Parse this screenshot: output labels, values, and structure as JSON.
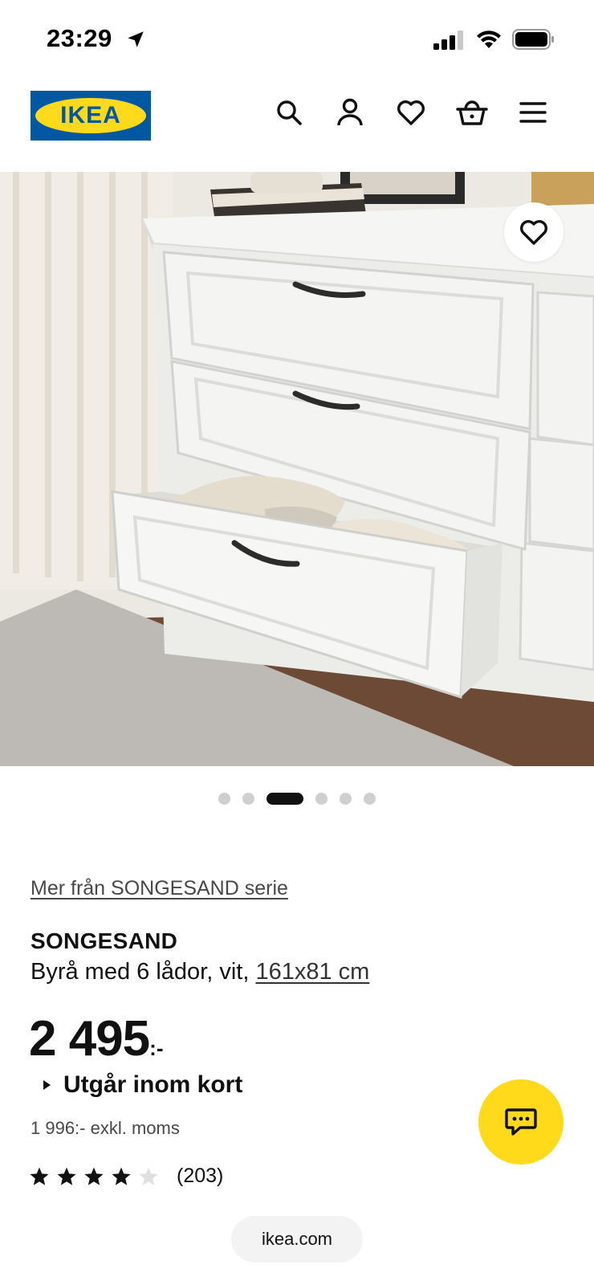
{
  "status_bar": {
    "time": "23:29",
    "icons": [
      "location-arrow-icon",
      "cellular-signal-icon",
      "wifi-icon",
      "battery-icon"
    ]
  },
  "header": {
    "logo_text": "IKEA",
    "icons": [
      "search-icon",
      "account-icon",
      "heart-icon",
      "basket-icon",
      "menu-icon"
    ],
    "colors": {
      "logo_blue": "#0058a3",
      "logo_yellow": "#ffda1a"
    }
  },
  "gallery": {
    "total_images": 6,
    "active_index": 2
  },
  "product": {
    "series_link": "Mer från SONGESAND serie",
    "name": "SONGESAND",
    "description": "Byrå med 6 lådor, vit, ",
    "dimensions": "161x81 cm",
    "price_integer": "2 495",
    "price_suffix": ":-",
    "availability": "Utgår inom kort",
    "price_excl_vat": "1 996:- exkl. moms",
    "rating": {
      "filled_stars": 4,
      "max_stars": 5,
      "count_label": "(203)"
    }
  },
  "chat": {
    "icon": "chat-icon",
    "color": "#ffda1a"
  },
  "browser": {
    "url": "ikea.com"
  }
}
